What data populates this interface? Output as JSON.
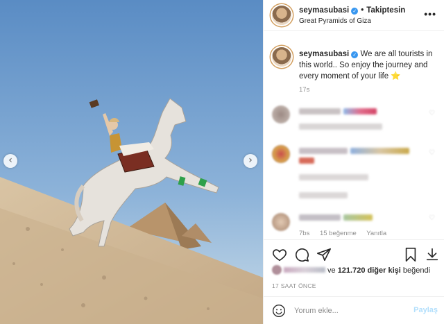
{
  "post": {
    "username": "seymasubasi",
    "follow_label": "Takiptesin",
    "location": "Great Pyramids of Giza",
    "more_label": "•••"
  },
  "caption": {
    "username": "seymasubasi",
    "text": "We are all tourists in this world.. So enjoy the journey and every moment of your life",
    "emoji": "⭐",
    "time": "17s"
  },
  "comments": [
    {
      "meta": []
    },
    {
      "meta": []
    },
    {
      "meta": [
        "7bs",
        "15 beğenme",
        "Yanıtla"
      ]
    }
  ],
  "likes": {
    "suffix": "ve",
    "count": "121.720 diğer kişi",
    "verb": "beğendi"
  },
  "posted_ago": "17 SAAT ÖNCE",
  "comment_box": {
    "placeholder": "Yorum ekle...",
    "post_label": "Paylaş"
  },
  "icons": {
    "heart": "heart-icon",
    "comment": "comment-icon",
    "share": "share-icon",
    "save": "bookmark-icon",
    "download": "download-icon",
    "emoji": "emoji-icon",
    "prev": "chevron-left-icon",
    "next": "chevron-right-icon"
  },
  "colors": {
    "verified": "#3897f0",
    "post_button_disabled": "#b2dffc",
    "sky": "#6f9ccd",
    "sand": "#d8c3a2"
  }
}
